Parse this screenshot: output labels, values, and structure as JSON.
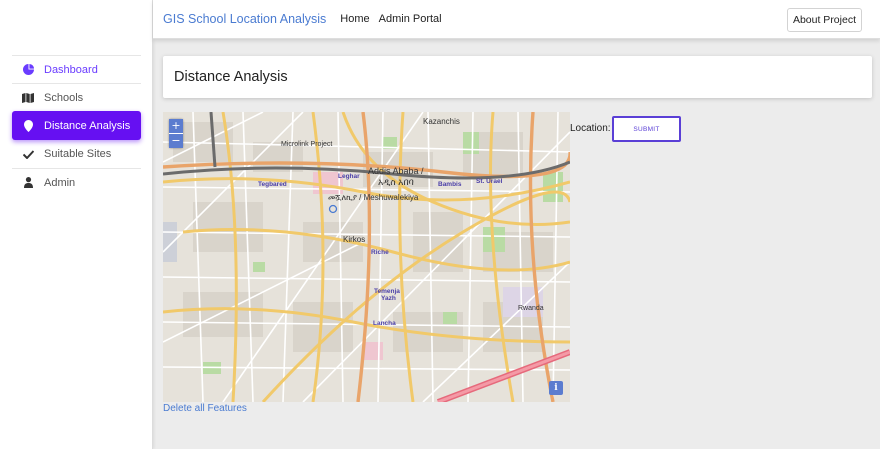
{
  "app": {
    "brand": "GIS School Location Analysis",
    "nav": [
      "Home",
      "Admin Portal"
    ],
    "about_button": "About Project"
  },
  "sidebar": {
    "items": [
      {
        "label": "Dashboard",
        "icon": "pie-chart-icon"
      },
      {
        "label": "Schools",
        "icon": "map-icon"
      },
      {
        "label": "Distance Analysis",
        "icon": "map-pin-icon"
      },
      {
        "label": "Suitable Sites",
        "icon": "check-icon"
      },
      {
        "label": "Admin",
        "icon": "user-icon"
      }
    ],
    "active": "Distance Analysis",
    "highlighted": "Dashboard"
  },
  "page": {
    "title": "Distance Analysis",
    "location_label": "Location:",
    "submit_label": "SUBMIT",
    "delete_link": "Delete all Features"
  },
  "map": {
    "zoom_in": "+",
    "zoom_out": "−",
    "info": "i",
    "labels": {
      "kazanchis": "Kazanchis",
      "addis": "Addis Ababa /",
      "addis_am": "አዲስ አበባ",
      "tegbared": "Tegbared",
      "leghar": "Leghar",
      "bambis": "Bambis",
      "sturael": "St. Urael",
      "meshuwalekiya": "መሿለኪያ / Meshuwalekiya",
      "kirkos": "Kirkos",
      "riche": "Riche",
      "temenja": "Temenja",
      "yazh": "Yazh",
      "lancha": "Lancha",
      "microlink": "Microlink Project",
      "rwanda": "Rwanda"
    }
  },
  "colors": {
    "accent": "#6610f2",
    "brand": "#4a7bd1",
    "submit": "#5a3fd6"
  }
}
